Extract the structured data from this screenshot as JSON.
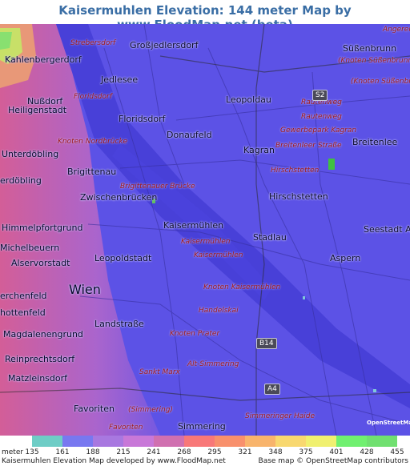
{
  "title": "Kaisermuhlen Elevation: 144 meter Map by www.FloodMap.net (beta)",
  "places": [
    {
      "text": "Angerer",
      "cls": "road"
    },
    {
      "text": "Strebersdorf",
      "cls": "road"
    },
    {
      "text": "Großjedlersdorf",
      "cls": "town"
    },
    {
      "text": "Süßenbrunn",
      "cls": "town"
    },
    {
      "text": "Kahlenbergerdorf",
      "cls": "town"
    },
    {
      "text": "(Knoten Süßenbrunn)",
      "cls": "road"
    },
    {
      "text": "Jedlesee",
      "cls": "town"
    },
    {
      "text": "(Knoten Süßenbr",
      "cls": "road"
    },
    {
      "text": "Nußdorf",
      "cls": "town"
    },
    {
      "text": "Floridsdorf",
      "cls": "road"
    },
    {
      "text": "Leopoldau",
      "cls": "town"
    },
    {
      "text": "Rautenweg",
      "cls": "road"
    },
    {
      "text": "Heiligenstadt",
      "cls": "town"
    },
    {
      "text": "Floridsdorf",
      "cls": "town"
    },
    {
      "text": "Rautenweg",
      "cls": "road"
    },
    {
      "text": "Donaufeld",
      "cls": "town"
    },
    {
      "text": "Gewerbepark Kagran",
      "cls": "road"
    },
    {
      "text": "Unterdöbling",
      "cls": "town"
    },
    {
      "text": "Knoten Nordbrücke",
      "cls": "road"
    },
    {
      "text": "Kagran",
      "cls": "town"
    },
    {
      "text": "Breitenleer Straße",
      "cls": "road"
    },
    {
      "text": "Breitenlee",
      "cls": "town"
    },
    {
      "text": "Brigittenau",
      "cls": "town"
    },
    {
      "text": "Hirschstetten",
      "cls": "road"
    },
    {
      "text": "erdöbling",
      "cls": "town"
    },
    {
      "text": "Brigittenauer Brücke",
      "cls": "road"
    },
    {
      "text": "Zwischenbrücken",
      "cls": "town"
    },
    {
      "text": "Hirschstetten",
      "cls": "town"
    },
    {
      "text": "Kaisermühlen",
      "cls": "town"
    },
    {
      "text": "Himmelpfortgrund",
      "cls": "town"
    },
    {
      "text": "Seestadt As",
      "cls": "town"
    },
    {
      "text": "Kaisermühlen",
      "cls": "road"
    },
    {
      "text": "Stadlau",
      "cls": "town"
    },
    {
      "text": "Michelbeuern",
      "cls": "town"
    },
    {
      "text": "Leopoldstadt",
      "cls": "town"
    },
    {
      "text": "Kaisermühlen",
      "cls": "road"
    },
    {
      "text": "Aspern",
      "cls": "town"
    },
    {
      "text": "Alservorstadt",
      "cls": "town"
    },
    {
      "text": "Knoten Kaisermühlen",
      "cls": "road"
    },
    {
      "text": "Wien",
      "cls": "town"
    },
    {
      "text": "erchenfeld",
      "cls": "town"
    },
    {
      "text": "Handelskai",
      "cls": "road"
    },
    {
      "text": "hottenfeld",
      "cls": "town"
    },
    {
      "text": "Landstraße",
      "cls": "town"
    },
    {
      "text": "Magdalenengrund",
      "cls": "town"
    },
    {
      "text": "Knoten Prater",
      "cls": "road"
    },
    {
      "text": "Reinprechtsdorf",
      "cls": "town"
    },
    {
      "text": "Alt-Simmering",
      "cls": "road"
    },
    {
      "text": "Sankt Marx",
      "cls": "road"
    },
    {
      "text": "Matzleinsdorf",
      "cls": "town"
    },
    {
      "text": "Favoriten",
      "cls": "town"
    },
    {
      "text": "(Simmering)",
      "cls": "road"
    },
    {
      "text": "Simmeringer Haide",
      "cls": "road"
    },
    {
      "text": "Favoriten",
      "cls": "road"
    },
    {
      "text": "Simmering",
      "cls": "town"
    }
  ],
  "shields": [
    "S2",
    "B14",
    "A4"
  ],
  "osm_logo": "OpenStreetMap",
  "legend": {
    "unit": "meter",
    "levels": [
      "135",
      "161",
      "188",
      "215",
      "241",
      "268",
      "295",
      "321",
      "348",
      "375",
      "401",
      "428",
      "455"
    ],
    "colors": [
      "#6ecdc6",
      "#7878f0",
      "#a878e0",
      "#c878d8",
      "#d070b0",
      "#f87878",
      "#f8906c",
      "#f8b46c",
      "#f8d870",
      "#f0f070",
      "#70f070",
      "#70e070"
    ]
  },
  "footer_left": "Kaisermuhlen Elevation Map developed by www.FloodMap.net",
  "footer_right": "Base map © OpenStreetMap contributors"
}
